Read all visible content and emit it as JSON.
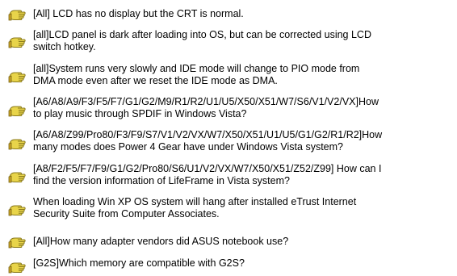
{
  "faq_list": {
    "items": [
      {
        "lines": [
          "[All] LCD has no display but the CRT is normal."
        ]
      },
      {
        "lines": [
          "[all]LCD panel is dark after loading into OS, but can be corrected using LCD",
          "switch hotkey."
        ]
      },
      {
        "lines": [
          "[all]System runs very slowly and IDE mode will change to PIO mode from",
          "DMA mode even after we reset the IDE mode as DMA."
        ]
      },
      {
        "lines": [
          "[A6/A8/A9/F3/F5/F7/G1/G2/M9/R1/R2/U1/U5/X50/X51/W7/S6/V1/V2/VX]How",
          "to play music through SPDIF in Windows Vista?"
        ]
      },
      {
        "lines": [
          "[A6/A8/Z99/Pro80/F3/F9/S7/V1/V2/VX/W7/X50/X51/U1/U5/G1/G2/R1/R2]How",
          "many modes does Power 4 Gear have under Windows Vista system?"
        ]
      },
      {
        "lines": [
          "[A8/F2/F5/F7/F9/G1/G2/Pro80/S6/U1/V2/VX/W7/X50/X51/Z52/Z99] How can I",
          "find the version information of LifeFrame in Vista system?"
        ]
      },
      {
        "lines": [
          "When loading Win XP OS system will hang after installed eTrust Internet",
          "Security Suite from Computer Associates."
        ]
      },
      {
        "lines": [
          "[All]How many adapter vendors did ASUS notebook use?"
        ]
      },
      {
        "lines": [
          "[G2S]Which memory are compatible with G2S?"
        ]
      }
    ],
    "icon": "pointing-hand-icon",
    "colors": {
      "text": "#000000",
      "background": "#ffffff",
      "icon_fill": "#e8d44a",
      "icon_stroke": "#8a7a1c"
    }
  }
}
